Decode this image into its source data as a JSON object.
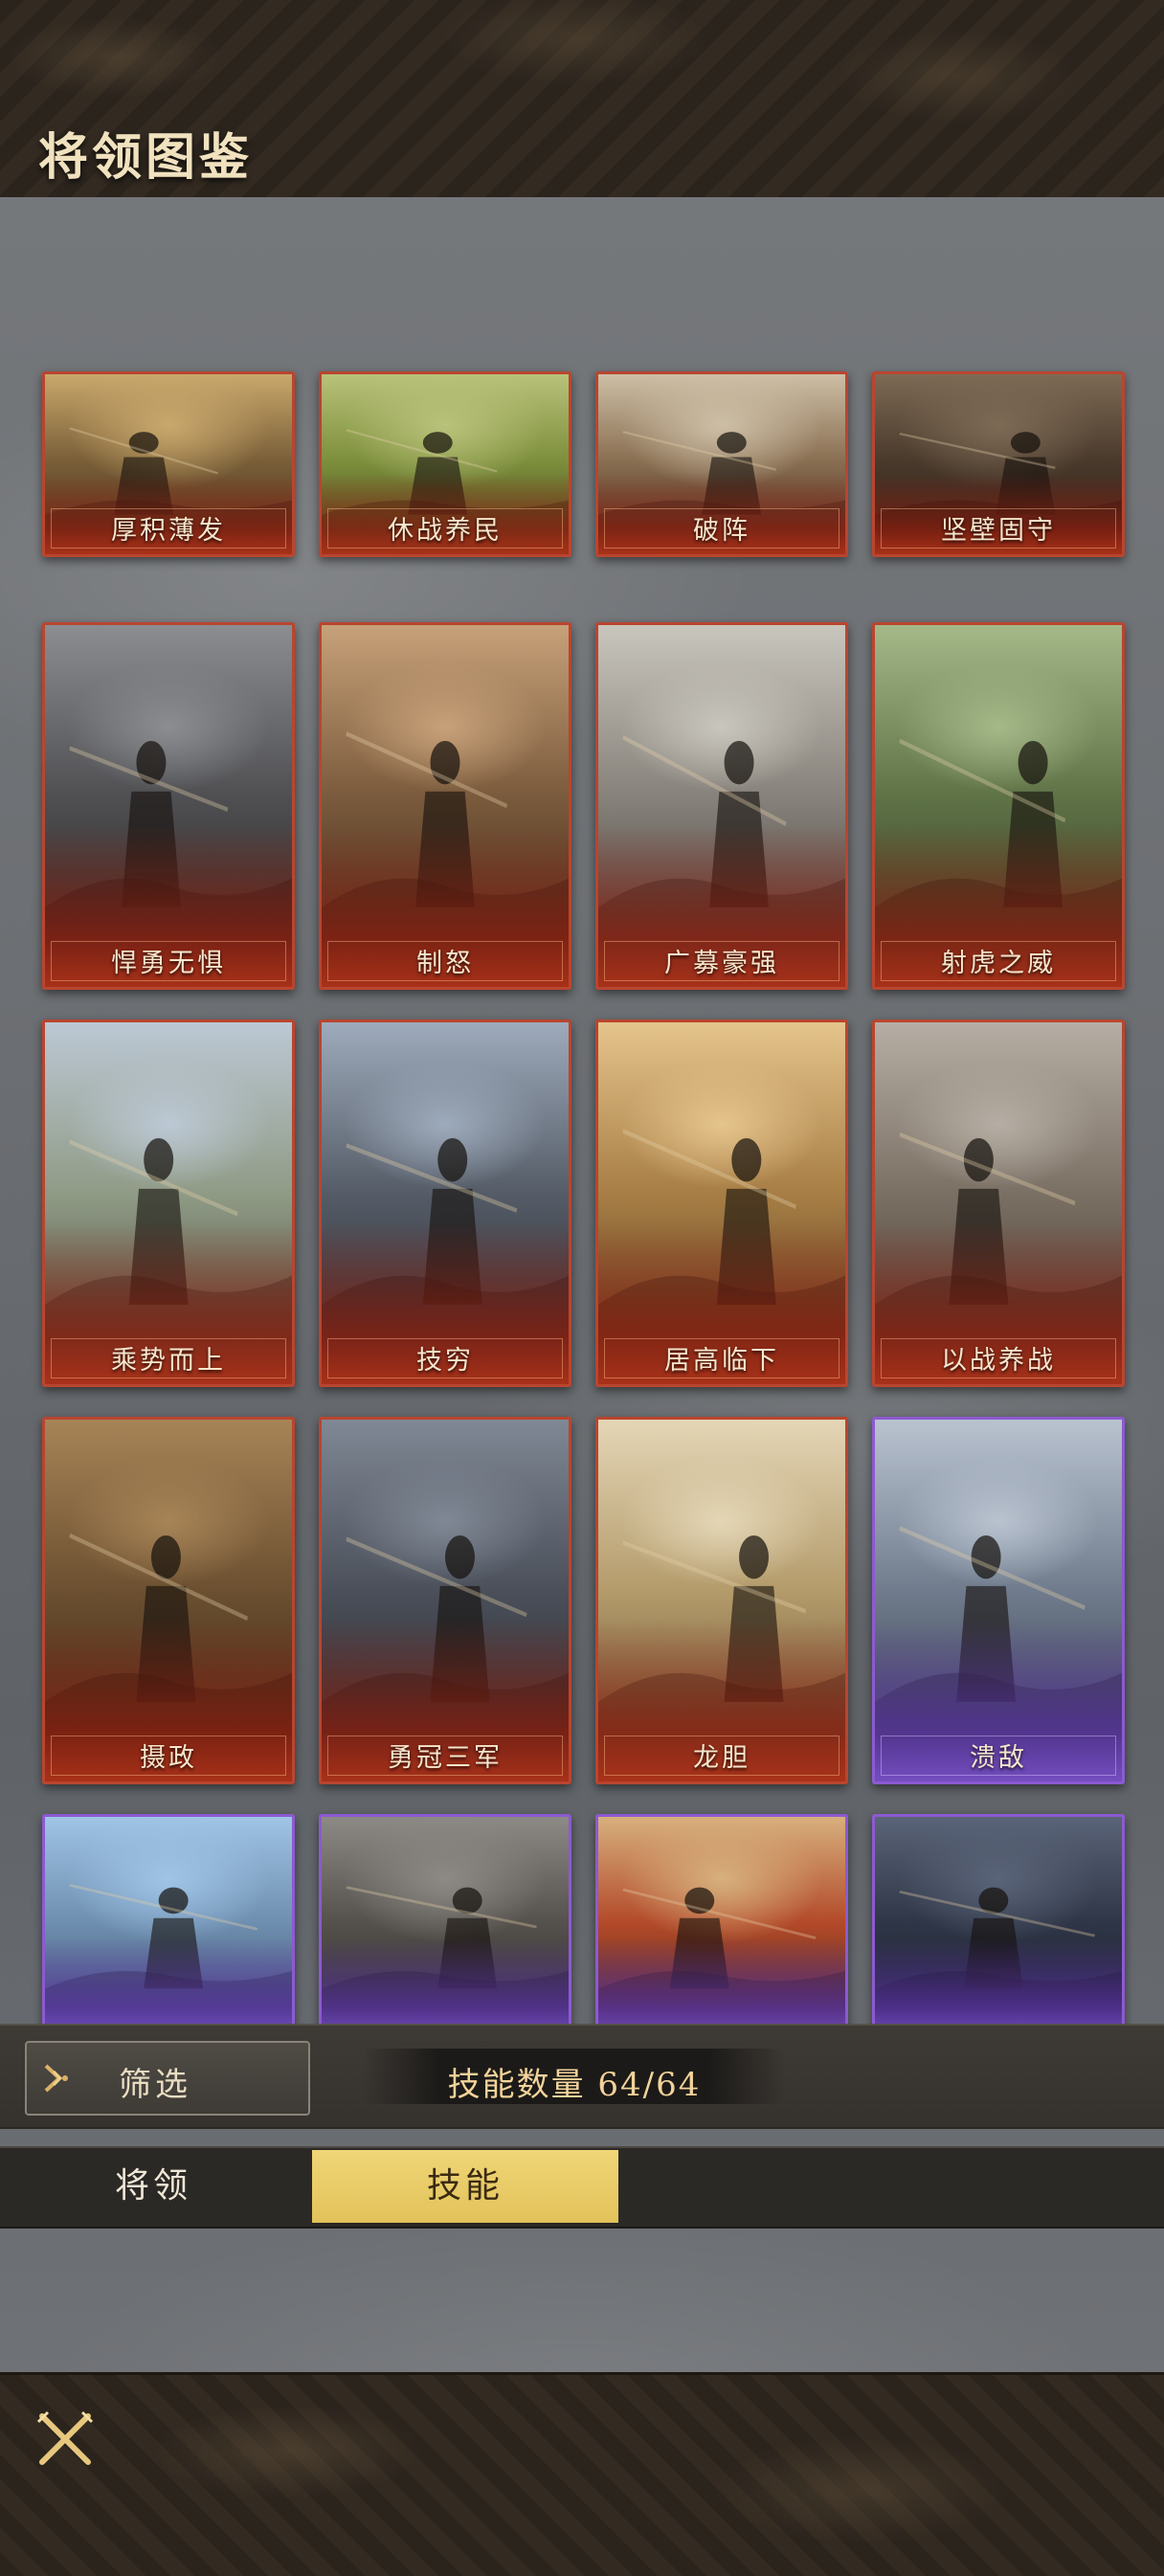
{
  "header": {
    "title": "将领图鉴"
  },
  "cards": [
    {
      "label": "厚积薄发",
      "rarity": "red",
      "theme": "army-formation"
    },
    {
      "label": "休战养民",
      "rarity": "red",
      "theme": "farmland"
    },
    {
      "label": "破阵",
      "rarity": "red",
      "theme": "cavalry-charge"
    },
    {
      "label": "坚壁固守",
      "rarity": "red",
      "theme": "shield-wall"
    },
    {
      "label": "悍勇无惧",
      "rarity": "red",
      "theme": "armored-warrior"
    },
    {
      "label": "制怒",
      "rarity": "red",
      "theme": "council-room"
    },
    {
      "label": "广募豪强",
      "rarity": "red",
      "theme": "recruitment"
    },
    {
      "label": "射虎之威",
      "rarity": "red",
      "theme": "archer-tiger"
    },
    {
      "label": "乘势而上",
      "rarity": "red",
      "theme": "mountain-march"
    },
    {
      "label": "技穷",
      "rarity": "red",
      "theme": "despair-tent"
    },
    {
      "label": "居高临下",
      "rarity": "red",
      "theme": "hilltop-view"
    },
    {
      "label": "以战养战",
      "rarity": "red",
      "theme": "plunder-town"
    },
    {
      "label": "摄政",
      "rarity": "red",
      "theme": "regent-throne"
    },
    {
      "label": "勇冠三军",
      "rarity": "red",
      "theme": "spear-storm"
    },
    {
      "label": "龙胆",
      "rarity": "red",
      "theme": "white-horse"
    },
    {
      "label": "溃敌",
      "rarity": "purple",
      "theme": "frozen-battle"
    },
    {
      "label": "",
      "rarity": "purple",
      "theme": "sword-sky"
    },
    {
      "label": "",
      "rarity": "purple",
      "theme": "cavalry-dusk"
    },
    {
      "label": "",
      "rarity": "purple",
      "theme": "fire-warrior"
    },
    {
      "label": "",
      "rarity": "purple",
      "theme": "night-gate"
    }
  ],
  "controls": {
    "filter_label": "筛选",
    "count_text": "技能数量 64/64"
  },
  "tabs": [
    {
      "label": "将领",
      "active": false
    },
    {
      "label": "技能",
      "active": true
    }
  ],
  "colors": {
    "red_border": "#b9452f",
    "purple_border": "#8c5ad1",
    "active_tab": "#e8c964",
    "title_text": "#f1e2bf"
  },
  "icons": {
    "filter": "chevron-right-icon",
    "close": "crossed-swords-icon"
  }
}
